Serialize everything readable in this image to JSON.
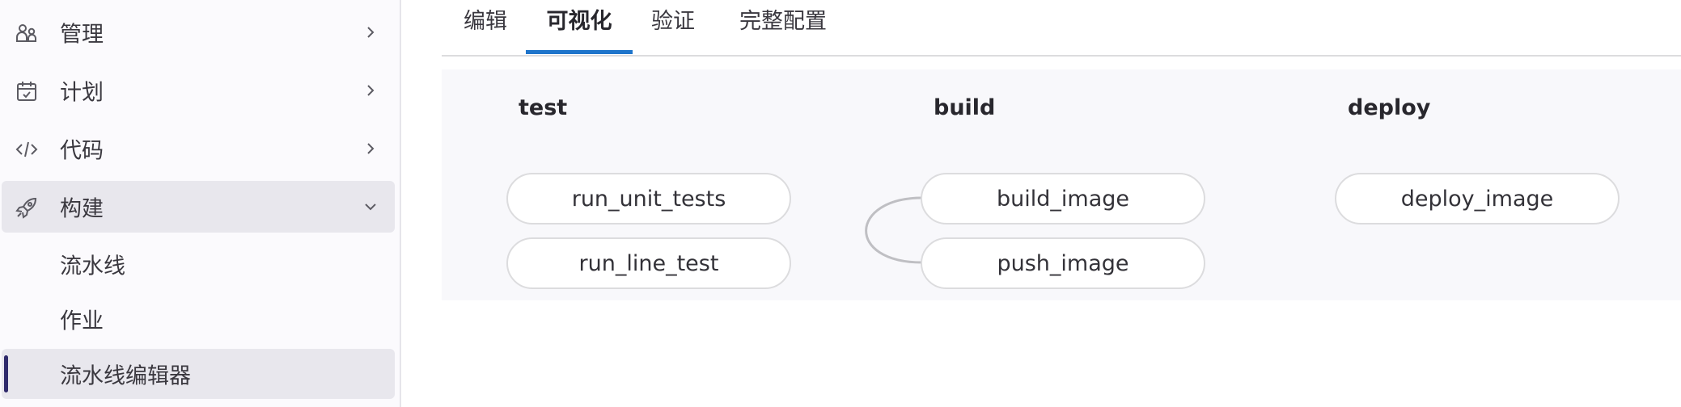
{
  "sidebar": {
    "items": [
      {
        "label": "管理",
        "icon": "users-icon",
        "expanded": false
      },
      {
        "label": "计划",
        "icon": "calendar-icon",
        "expanded": false
      },
      {
        "label": "代码",
        "icon": "code-icon",
        "expanded": false
      },
      {
        "label": "构建",
        "icon": "rocket-icon",
        "expanded": true
      }
    ],
    "subitems": [
      {
        "label": "流水线",
        "current": false
      },
      {
        "label": "作业",
        "current": false
      },
      {
        "label": "流水线编辑器",
        "current": true
      }
    ]
  },
  "tabs": [
    {
      "label": "编辑",
      "selected": false
    },
    {
      "label": "可视化",
      "selected": true
    },
    {
      "label": "验证",
      "selected": false
    },
    {
      "label": "完整配置",
      "selected": false
    }
  ],
  "pipeline": {
    "stages": [
      {
        "name": "test",
        "jobs": [
          "run_unit_tests",
          "run_line_test"
        ]
      },
      {
        "name": "build",
        "jobs": [
          "build_image",
          "push_image"
        ]
      },
      {
        "name": "deploy",
        "jobs": [
          "deploy_image"
        ]
      }
    ]
  },
  "colors": {
    "tab_accent": "#1f75cb",
    "current_indicator": "#2f2a6b",
    "link_line": "#bfbfc3"
  }
}
